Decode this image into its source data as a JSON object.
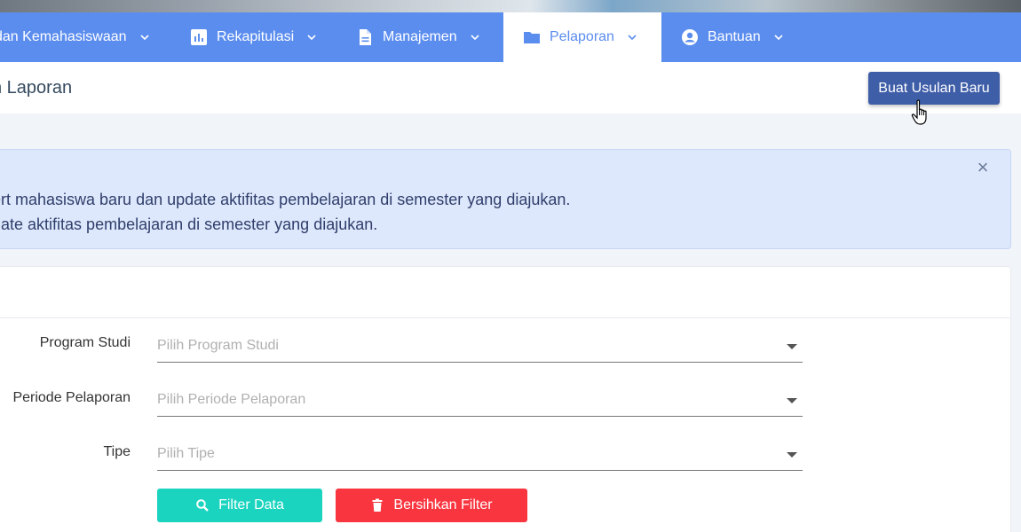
{
  "navbar": {
    "items": [
      {
        "label": "dan Kemahasiswaan",
        "icon": "none"
      },
      {
        "label": "Rekapitulasi",
        "icon": "bar-chart-icon"
      },
      {
        "label": "Manajemen",
        "icon": "document-icon"
      },
      {
        "label": "Pelaporan",
        "icon": "folder-icon",
        "active": true
      },
      {
        "label": "Bantuan",
        "icon": "user-circle-icon"
      }
    ]
  },
  "header": {
    "title": "n Laporan",
    "new_button": "Buat Usulan Baru"
  },
  "alert": {
    "line1": "ert mahasiswa baru dan update aktifitas pembelajaran di semester yang diajukan.",
    "line2": "date aktifitas pembelajaran di semester yang diajukan.",
    "close": "×"
  },
  "form": {
    "program_studi": {
      "label": "Program Studi",
      "placeholder": "Pilih Program Studi"
    },
    "periode": {
      "label": "Periode Pelaporan",
      "placeholder": "Pilih Periode Pelaporan"
    },
    "tipe": {
      "label": "Tipe",
      "placeholder": "Pilih Tipe"
    },
    "filter_button": "Filter Data",
    "clear_button": "Bersihkan Filter"
  },
  "colors": {
    "navbar": "#5b8def",
    "primary_button": "#3f5ea8",
    "filter_button": "#1bd4bf",
    "clear_button": "#f9353f",
    "alert_bg": "#dee8fc"
  }
}
